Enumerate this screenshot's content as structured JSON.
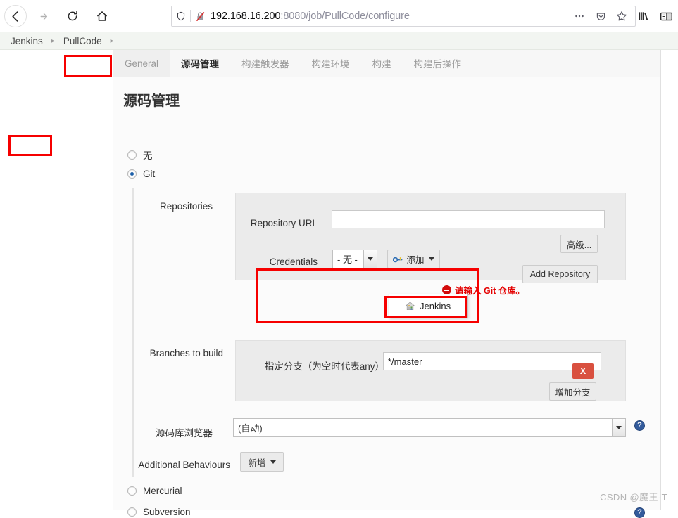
{
  "browser": {
    "nav": {
      "back": "back-arrow",
      "forward": "forward-arrow",
      "reload": "reload",
      "home": "home"
    },
    "url": {
      "host": "192.168.16.200",
      "path": ":8080/job/PullCode/configure",
      "full": "192.168.16.200:8080/job/PullCode/configure",
      "shield_icon": "shield-icon",
      "insecure_icon": "broken-lock-icon"
    },
    "toolbar_right": [
      "page-actions-icon",
      "pocket-icon",
      "bookmark-star-icon",
      "library-icon",
      "sidebar-icon"
    ]
  },
  "breadcrumb": {
    "items": [
      "Jenkins",
      "PullCode"
    ],
    "separator": "▸"
  },
  "tabs": [
    {
      "label": "General",
      "active": false
    },
    {
      "label": "源码管理",
      "active": true
    },
    {
      "label": "构建触发器",
      "active": false
    },
    {
      "label": "构建环境",
      "active": false
    },
    {
      "label": "构建",
      "active": false
    },
    {
      "label": "构建后操作",
      "active": false
    }
  ],
  "page": {
    "title": "源码管理"
  },
  "scm_options": [
    {
      "label": "无",
      "checked": false
    },
    {
      "label": "Git",
      "checked": true
    },
    {
      "label": "Mercurial",
      "checked": false
    },
    {
      "label": "Subversion",
      "checked": false
    }
  ],
  "git": {
    "repositories": {
      "label": "Repositories",
      "repository_url": {
        "label": "Repository URL",
        "value": "",
        "placeholder": ""
      },
      "error": {
        "icon": "error-circle-icon",
        "text": "请输入 Git 仓库。"
      },
      "credentials": {
        "label": "Credentials",
        "selected": "- 无 -",
        "add_button": {
          "label": "添加",
          "icon": "key-icon"
        },
        "menu": [
          {
            "label": "Jenkins",
            "icon": "jenkins-home-icon"
          }
        ]
      },
      "advanced_button": "高级...",
      "add_repository_button": "Add Repository"
    },
    "branches": {
      "label": "Branches to build",
      "delete_button": "X",
      "branch_spec": {
        "label": "指定分支（为空时代表any）",
        "value": "*/master"
      },
      "add_branch_button": "增加分支"
    },
    "repo_browser": {
      "label": "源码库浏览器",
      "selected": "(自动)"
    },
    "additional_behaviours": {
      "label": "Additional Behaviours",
      "add_button": "新增"
    }
  },
  "help_icon": "?",
  "watermark": "CSDN @魔王-T",
  "colors": {
    "highlight_red": "#f60000",
    "error_red": "#e40000",
    "delete_red": "#d9503f",
    "help_blue": "#335b9c",
    "radio_blue": "#1c5fa8"
  }
}
